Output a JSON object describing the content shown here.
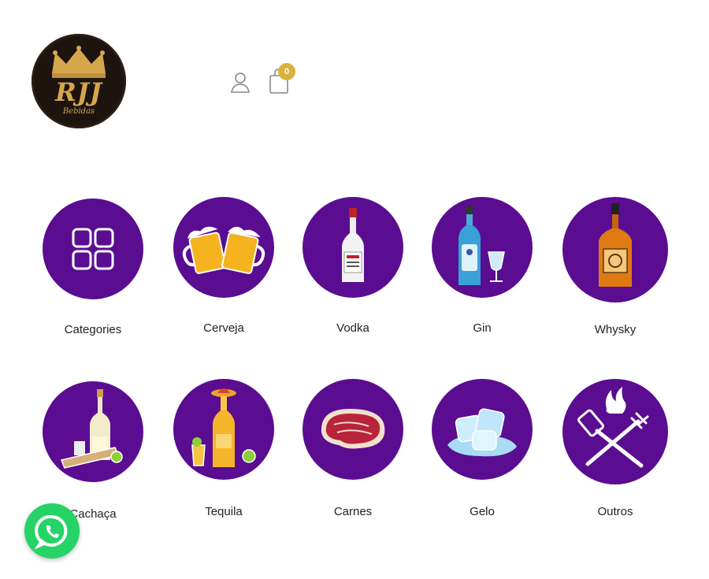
{
  "brand": {
    "monogram": "RJJ",
    "subtitle": "Bebidas",
    "colors": {
      "logo_bg": "#1d1410",
      "gold": "#d6a64d"
    }
  },
  "header": {
    "user_icon": "user-icon",
    "cart_icon": "shopping-bag-icon",
    "cart_count": "0"
  },
  "categories": [
    {
      "label": "Categories",
      "icon": "grid-icon"
    },
    {
      "label": "Cerveja",
      "icon": "beer-mugs-icon"
    },
    {
      "label": "Vodka",
      "icon": "vodka-bottle-icon"
    },
    {
      "label": "Gin",
      "icon": "gin-bottle-icon"
    },
    {
      "label": "Whysky",
      "icon": "whisky-bottle-icon"
    },
    {
      "label": "Cachaça",
      "icon": "cachaca-bottle-icon"
    },
    {
      "label": "Tequila",
      "icon": "tequila-bottle-icon"
    },
    {
      "label": "Carnes",
      "icon": "steak-icon"
    },
    {
      "label": "Gelo",
      "icon": "ice-cubes-icon"
    },
    {
      "label": "Outros",
      "icon": "grill-tools-icon"
    }
  ],
  "floating": {
    "icon": "whatsapp-icon"
  },
  "colors": {
    "category_circle": "#5a0d91",
    "badge": "#d8b23c",
    "whatsapp": "#25d366"
  }
}
